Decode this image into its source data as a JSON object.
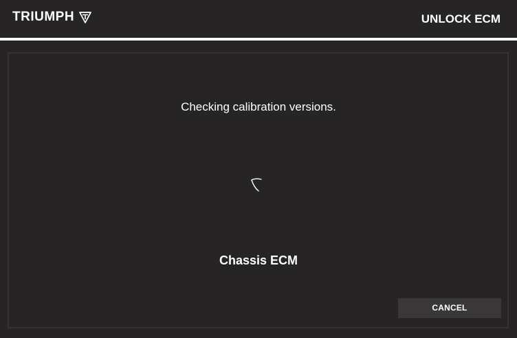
{
  "header": {
    "brand": "TRIUMPH",
    "brand_icon": "triumph-shield-icon",
    "title": "UNLOCK ECM"
  },
  "main": {
    "status_text": "Checking calibration versions.",
    "spinner_icon": "loading-spinner-icon",
    "module_name": "Chassis ECM"
  },
  "actions": {
    "cancel_label": "CANCEL"
  },
  "colors": {
    "background": "#272425",
    "text": "#ffffff",
    "button": "#3a3738",
    "panel_border": "#353233"
  }
}
